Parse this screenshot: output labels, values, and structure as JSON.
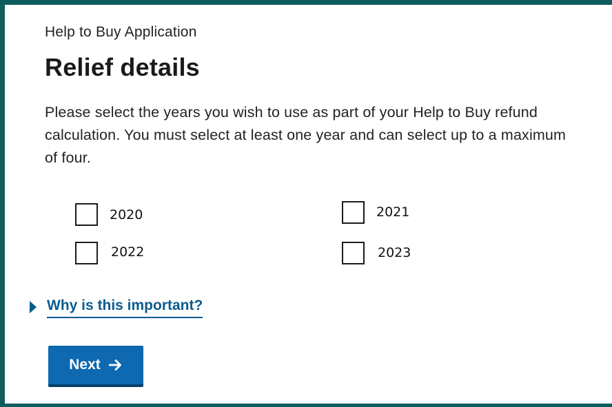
{
  "header": {
    "breadcrumb": "Help to Buy Application",
    "title": "Relief details"
  },
  "main": {
    "intro_text": "Please select the years you wish to use as part of your Help to Buy refund calculation. You must select at least one year and can select up to a maximum of four.",
    "years": [
      {
        "label": "2020",
        "checked": false
      },
      {
        "label": "2021",
        "checked": false
      },
      {
        "label": "2022",
        "checked": false
      },
      {
        "label": "2023",
        "checked": false
      }
    ],
    "details_link": "Why is this important?",
    "next_label": "Next"
  },
  "colors": {
    "frame_border": "#0f5c5c",
    "link": "#0b5c8f",
    "button_bg": "#0e69b0",
    "button_shadow": "#06406c",
    "text": "#222222"
  },
  "icons": {
    "expander": "triangle-right-icon",
    "next": "arrow-right-icon"
  }
}
